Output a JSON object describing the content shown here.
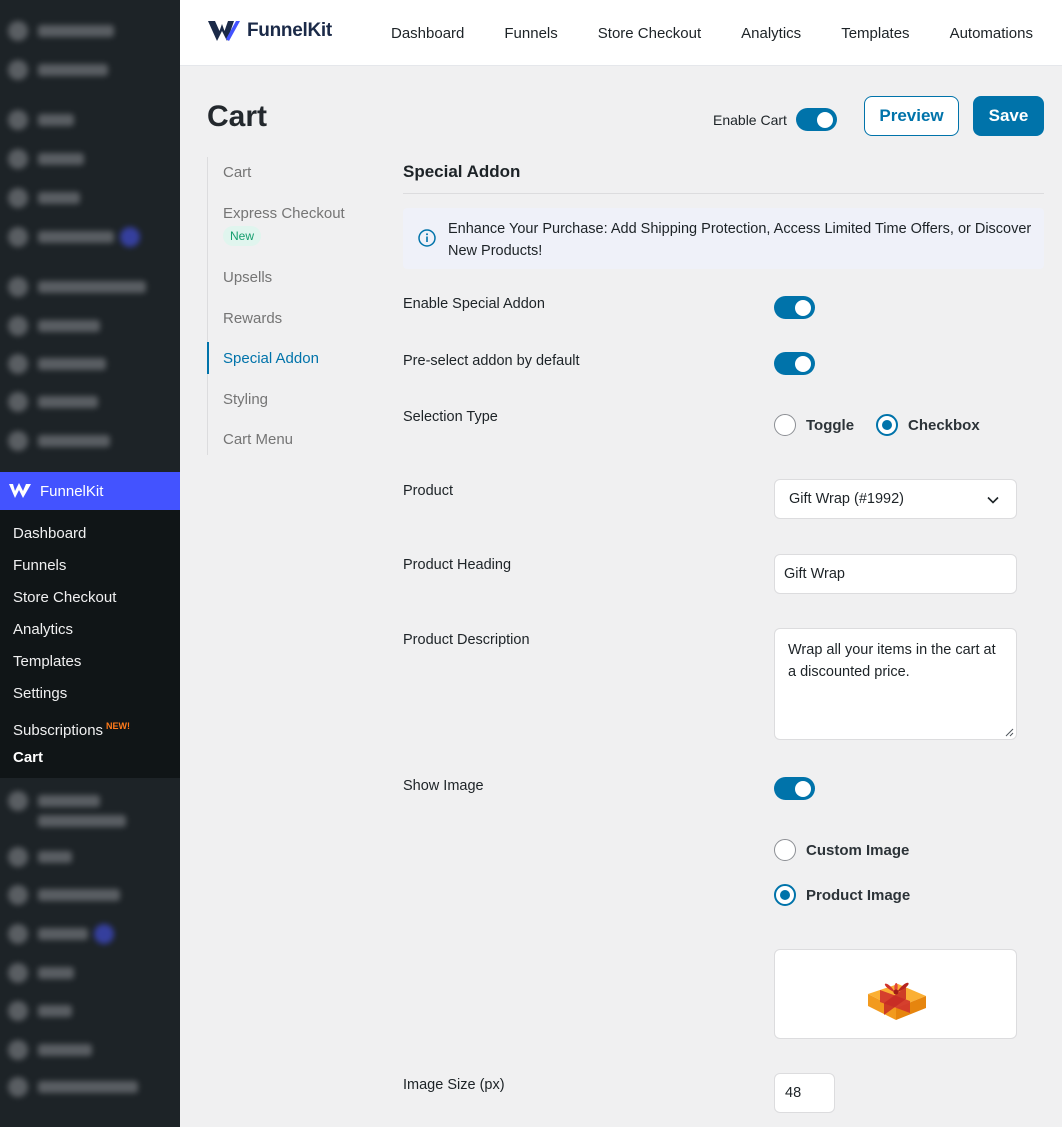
{
  "brand": {
    "name": "FunnelKit"
  },
  "topnav": [
    "Dashboard",
    "Funnels",
    "Store Checkout",
    "Analytics",
    "Templates",
    "Automations"
  ],
  "wp_menu": {
    "active_plugin": "FunnelKit",
    "submenu": [
      "Dashboard",
      "Funnels",
      "Store Checkout",
      "Analytics",
      "Templates",
      "Settings",
      "Subscriptions",
      "Cart"
    ],
    "subscriptions_flag": "NEW!",
    "current": "Cart"
  },
  "page": {
    "title": "Cart",
    "enable_cart_label": "Enable Cart",
    "enable_cart_on": true,
    "preview_label": "Preview",
    "save_label": "Save"
  },
  "settings_nav": {
    "items": [
      "Cart",
      "Express Checkout",
      "Upsells",
      "Rewards",
      "Special Addon",
      "Styling",
      "Cart Menu"
    ],
    "express_badge": "New",
    "active": "Special Addon"
  },
  "panel": {
    "title": "Special Addon",
    "notice": "Enhance Your Purchase: Add Shipping Protection, Access Limited Time Offers, or Discover New Products!",
    "enable_label": "Enable Special Addon",
    "enable_on": true,
    "preselect_label": "Pre-select addon by default",
    "preselect_on": true,
    "selection_type_label": "Selection Type",
    "selection_options": [
      "Toggle",
      "Checkbox"
    ],
    "selection_selected": "Checkbox",
    "product_label": "Product",
    "product_value": "Gift Wrap (#1992)",
    "product_heading_label": "Product Heading",
    "product_heading_value": "Gift Wrap",
    "product_description_label": "Product Description",
    "product_description_value": "Wrap all your items in the cart at a discounted price.",
    "show_image_label": "Show Image",
    "show_image_on": true,
    "image_options": [
      "Custom Image",
      "Product Image"
    ],
    "image_selected": "Product Image",
    "image_size_label": "Image Size (px)",
    "image_size_value": "48"
  },
  "colors": {
    "accent": "#0073aa",
    "wp_sidebar": "#1d2327",
    "funnelkit_blue": "#4353ff",
    "notice_bg": "#eff1f9"
  }
}
